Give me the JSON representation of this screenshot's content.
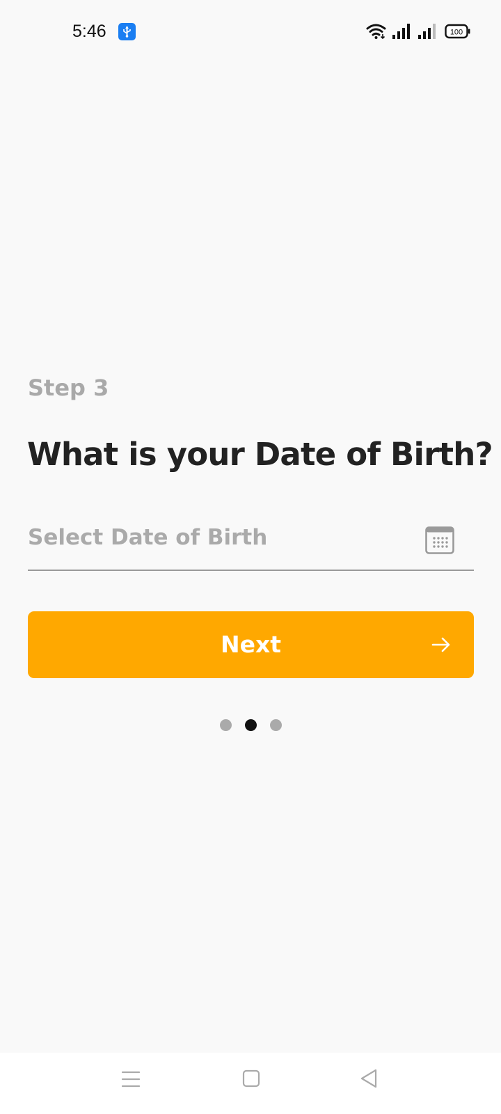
{
  "status_bar": {
    "time": "5:46",
    "usb_icon": "usb-icon",
    "wifi_icon": "wifi-icon",
    "signal_icons": [
      "signal-icon",
      "signal-icon"
    ],
    "battery_level": "100"
  },
  "onboarding": {
    "step_label": "Step 3",
    "question": "What is your Date of Birth?",
    "dob_field": {
      "placeholder": "Select Date of Birth",
      "icon": "calendar-icon"
    },
    "next_button": {
      "label": "Next",
      "icon": "arrow-right-icon"
    },
    "pager": {
      "total": 3,
      "active_index": 1
    }
  },
  "colors": {
    "accent": "#FFA800",
    "background": "#F9F9F9",
    "title": "#222222",
    "muted": "#AAAAAA",
    "usb_badge": "#1A7EF2"
  },
  "nav_bar": {
    "icons": [
      "menu-icon",
      "home-icon",
      "back-icon"
    ]
  }
}
